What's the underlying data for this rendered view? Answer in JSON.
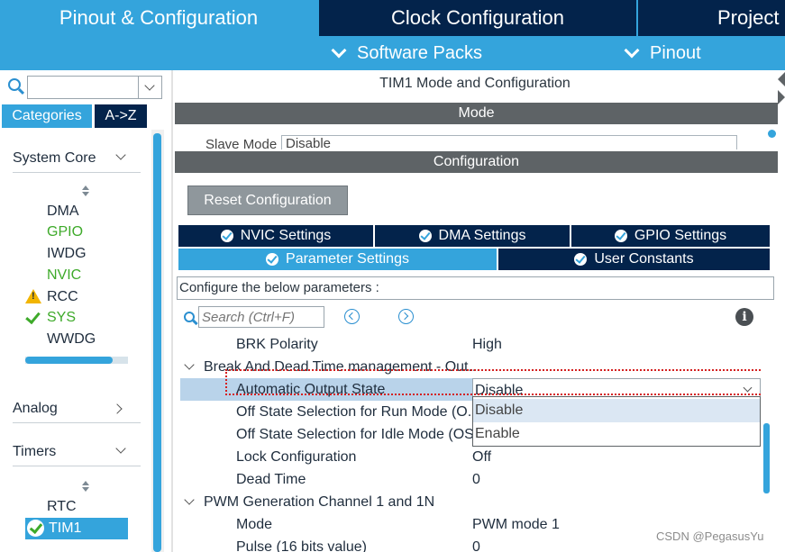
{
  "top_tabs": {
    "pinout_config": "Pinout & Configuration",
    "clock_config": "Clock Configuration",
    "project": "Project"
  },
  "sub_menu": {
    "software_packs": "Software Packs",
    "pinout": "Pinout"
  },
  "left": {
    "search_value": "",
    "categories_tab": "Categories",
    "az_tab": "A->Z",
    "system_core": "System Core",
    "system_core_items": [
      {
        "label": "DMA",
        "status": "none"
      },
      {
        "label": "GPIO",
        "status": "enabled"
      },
      {
        "label": "IWDG",
        "status": "none"
      },
      {
        "label": "NVIC",
        "status": "enabled"
      },
      {
        "label": "RCC",
        "status": "warning"
      },
      {
        "label": "SYS",
        "status": "ok"
      },
      {
        "label": "WWDG",
        "status": "none"
      }
    ],
    "analog": "Analog",
    "timers": "Timers",
    "timers_items": [
      {
        "label": "RTC"
      },
      {
        "label": "TIM1",
        "selected": true
      }
    ],
    "scroll_progress": 0.85
  },
  "right": {
    "mode_title": "TIM1 Mode and Configuration",
    "mode_header": "Mode",
    "mode_clipped_label": "Slave Mode",
    "mode_clipped_value": "Disable",
    "config_header": "Configuration",
    "reset_button": "Reset Configuration",
    "tabs_row1": [
      "NVIC Settings",
      "DMA Settings",
      "GPIO Settings"
    ],
    "tabs_row2": [
      "Parameter Settings",
      "User Constants"
    ],
    "param_description": "Configure the below parameters :",
    "search_placeholder": "Search (Ctrl+F)",
    "rows": [
      {
        "type": "param",
        "name": "BRK Polarity",
        "value": "High"
      },
      {
        "type": "group",
        "name": "Break And Dead Time management - Out..."
      },
      {
        "type": "param",
        "name": "Automatic Output State",
        "value": "Disable",
        "selected": true
      },
      {
        "type": "param",
        "name": "Off State Selection for Run Mode (O...",
        "value": ""
      },
      {
        "type": "param",
        "name": "Off State Selection for Idle Mode (OS...",
        "value": ""
      },
      {
        "type": "param",
        "name": "Lock Configuration",
        "value": "Off"
      },
      {
        "type": "param",
        "name": "Dead Time",
        "value": "0"
      },
      {
        "type": "group",
        "name": "PWM Generation Channel 1 and 1N"
      },
      {
        "type": "param",
        "name": "Mode",
        "value": "PWM mode 1"
      },
      {
        "type": "param",
        "name": "Pulse (16 bits value)",
        "value": "0"
      }
    ],
    "dropdown_options": [
      "Disable",
      "Enable"
    ],
    "dropdown_highlighted": "Disable"
  },
  "watermark": "CSDN @PegasusYu",
  "colors": {
    "accent": "#34a4dc",
    "dark_navy": "#03234b",
    "header_gray": "#5e6366",
    "enabled_green": "#3eaa2a",
    "warning_yellow": "#f2b500",
    "highlight_red": "#d42020"
  },
  "icons": [
    "search-icon",
    "chevron-down-icon",
    "sort-icon",
    "warning-icon",
    "check-icon",
    "check-circle-icon",
    "nav-prev-icon",
    "nav-next-icon",
    "info-icon"
  ]
}
